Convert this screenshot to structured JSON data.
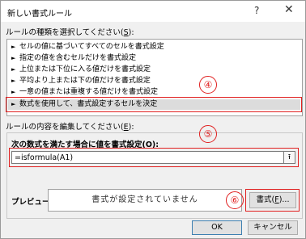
{
  "window": {
    "title": "新しい書式ルール",
    "help_icon": "?",
    "close_icon": "✕"
  },
  "rule_type": {
    "label_before": "ルールの種類を選択してください(",
    "label_key": "S",
    "label_after": "):",
    "items": [
      {
        "label": "セルの値に基づいてすべてのセルを書式設定"
      },
      {
        "label": "指定の値を含むセルだけを書式設定"
      },
      {
        "label": "上位または下位に入る値だけを書式設定"
      },
      {
        "label": "平均より上または下の値だけを書式設定"
      },
      {
        "label": "一意の値または重複する値だけを書式設定"
      },
      {
        "label": "数式を使用して、書式設定するセルを決定"
      }
    ]
  },
  "rule_desc": {
    "label_before": "ルールの内容を編集してください(",
    "label_key": "E",
    "label_after": "):",
    "formula_label_before": "次の数式を満たす場合に値を書式設定(",
    "formula_label_key": "O",
    "formula_label_after": "):",
    "formula_value": "=isformula(A1)",
    "collapse_icon": "⭱"
  },
  "preview": {
    "label": "プレビュー:",
    "text": "書式が設定されていません",
    "format_button_before": "書式(",
    "format_button_key": "F",
    "format_button_after": ")..."
  },
  "buttons": {
    "ok": "OK",
    "cancel": "キャンセル"
  },
  "callouts": [
    "④",
    "⑤",
    "⑥"
  ],
  "colors": {
    "accent": "#e02020",
    "selected": "#dcdcdc",
    "dialog_bg": "#f0f0f0"
  }
}
